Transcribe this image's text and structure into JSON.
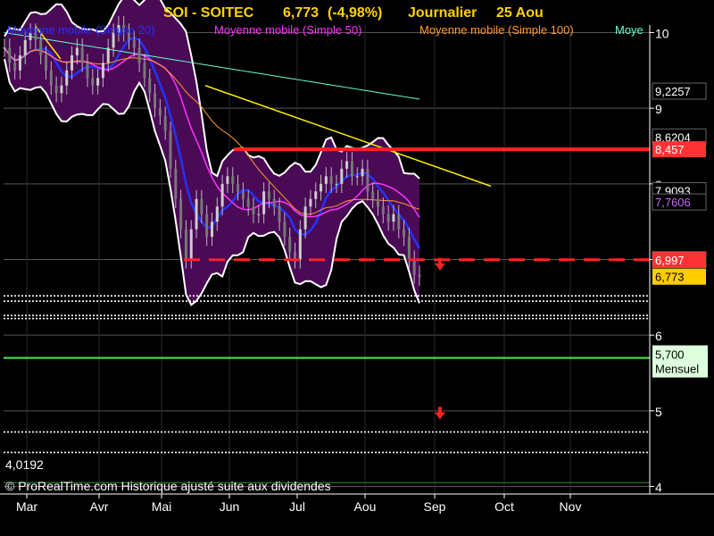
{
  "chart_data": {
    "type": "candlestick",
    "title": {
      "symbol": "SOI - SOITEC",
      "last": "6,773",
      "change": "(-4,98%)",
      "period": "Journalier",
      "date": "25 Aou"
    },
    "legend": [
      {
        "label": "Moyenne mobile (Simple 20)",
        "color": "#2233ff"
      },
      {
        "label": "Moyenne mobile (Simple 50)",
        "color": "#ff33ff"
      },
      {
        "label": "Moyenne mobile (Simple 100)",
        "color": "#ff9933"
      },
      {
        "label": "Moye",
        "color": "#66ffcc"
      }
    ],
    "y_axis": {
      "min": 3.9,
      "max": 10.1,
      "scale": "linear",
      "ticks": [
        "10",
        "9",
        "8",
        "7",
        "6",
        "5",
        "4"
      ]
    },
    "x_axis": {
      "labels": [
        "Mar",
        "Avr",
        "Mai",
        "Jun",
        "Jul",
        "Aou",
        "Sep",
        "Oct",
        "Nov"
      ]
    },
    "price_tags": [
      {
        "text": "9,2257",
        "value": 9.2257,
        "bg": "#000000",
        "color": "#ffffff"
      },
      {
        "text": "8,6204",
        "value": 8.6204,
        "bg": "#000000",
        "color": "#ffffff"
      },
      {
        "text": "8,457",
        "value": 8.457,
        "bg": "#ff3333",
        "color": "#ffffff"
      },
      {
        "text": "7,9093",
        "value": 7.9093,
        "bg": "#000000",
        "color": "#ffffff"
      },
      {
        "text": "7,7606",
        "value": 7.7606,
        "bg": "#000000",
        "color": "#cc66ff"
      },
      {
        "text": "6,9977",
        "value": 6.9977,
        "bg": "#000000",
        "color": "#ffffff"
      },
      {
        "text": "6,997",
        "value": 6.997,
        "bg": "#ff3333",
        "color": "#ffffff"
      },
      {
        "text": "6,773",
        "value": 6.773,
        "bg": "#ffcc00",
        "color": "#000000"
      }
    ],
    "support_level": {
      "value": 5.7,
      "label": "5,700",
      "sublabel": "Mensuel",
      "color": "#44ee44"
    },
    "resistance_line": {
      "value": 8.457,
      "color": "#ff2222"
    },
    "support_dashed": {
      "value": 6.997,
      "color": "#ff2222"
    },
    "low_label": "4,0192",
    "footer": "© ProRealTime.com Historique ajusté suite aux dividendes",
    "close_series": [
      9.8,
      9.6,
      9.5,
      9.7,
      9.9,
      10.0,
      9.9,
      9.7,
      9.5,
      9.3,
      9.2,
      9.3,
      9.5,
      9.7,
      9.8,
      9.6,
      9.4,
      9.3,
      9.4,
      9.6,
      9.8,
      10.0,
      10.1,
      10.0,
      9.9,
      9.8,
      9.6,
      9.4,
      9.2,
      9.0,
      8.9,
      8.7,
      8.2,
      7.8,
      7.4,
      7.0,
      7.4,
      7.8,
      7.6,
      7.3,
      7.5,
      7.7,
      8.0,
      8.1,
      8.0,
      7.9,
      7.8,
      7.7,
      7.6,
      7.6,
      7.9,
      7.8,
      7.7,
      7.5,
      7.3,
      7.1,
      7.0,
      7.4,
      7.7,
      7.8,
      7.9,
      8.0,
      8.1,
      8.0,
      8.0,
      8.2,
      8.3,
      8.1,
      8.1,
      8.2,
      7.9,
      7.8,
      7.7,
      7.6,
      7.5,
      7.6,
      7.4,
      7.3,
      7.0,
      6.8,
      6.773
    ]
  }
}
